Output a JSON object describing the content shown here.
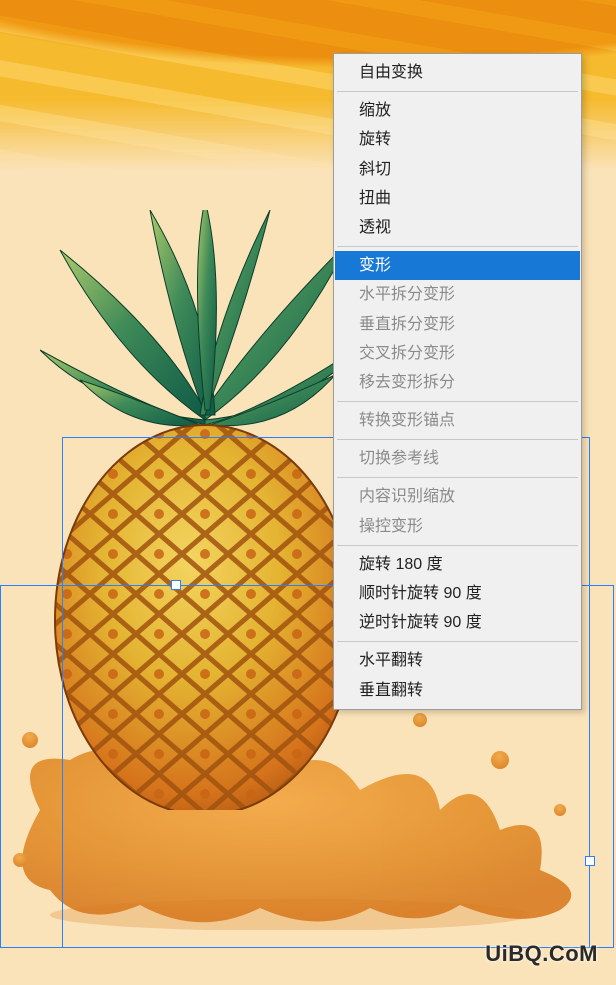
{
  "menu": {
    "groups": [
      [
        {
          "label": "自由变换",
          "enabled": true,
          "highlight": false,
          "name": "menu-free-transform"
        }
      ],
      [
        {
          "label": "缩放",
          "enabled": true,
          "highlight": false,
          "name": "menu-scale"
        },
        {
          "label": "旋转",
          "enabled": true,
          "highlight": false,
          "name": "menu-rotate"
        },
        {
          "label": "斜切",
          "enabled": true,
          "highlight": false,
          "name": "menu-skew"
        },
        {
          "label": "扭曲",
          "enabled": true,
          "highlight": false,
          "name": "menu-distort"
        },
        {
          "label": "透视",
          "enabled": true,
          "highlight": false,
          "name": "menu-perspective"
        }
      ],
      [
        {
          "label": "变形",
          "enabled": true,
          "highlight": true,
          "name": "menu-warp"
        },
        {
          "label": "水平拆分变形",
          "enabled": false,
          "highlight": false,
          "name": "menu-split-warp-h"
        },
        {
          "label": "垂直拆分变形",
          "enabled": false,
          "highlight": false,
          "name": "menu-split-warp-v"
        },
        {
          "label": "交叉拆分变形",
          "enabled": false,
          "highlight": false,
          "name": "menu-split-warp-cross"
        },
        {
          "label": "移去变形拆分",
          "enabled": false,
          "highlight": false,
          "name": "menu-remove-warp-split"
        }
      ],
      [
        {
          "label": "转换变形锚点",
          "enabled": false,
          "highlight": false,
          "name": "menu-convert-warp-anchor"
        }
      ],
      [
        {
          "label": "切换参考线",
          "enabled": false,
          "highlight": false,
          "name": "menu-toggle-guides"
        }
      ],
      [
        {
          "label": "内容识别缩放",
          "enabled": false,
          "highlight": false,
          "name": "menu-content-aware-scale"
        },
        {
          "label": "操控变形",
          "enabled": false,
          "highlight": false,
          "name": "menu-puppet-warp"
        }
      ],
      [
        {
          "label": "旋转 180 度",
          "enabled": true,
          "highlight": false,
          "name": "menu-rotate-180"
        },
        {
          "label": "顺时针旋转 90 度",
          "enabled": true,
          "highlight": false,
          "name": "menu-rotate-90-cw"
        },
        {
          "label": "逆时针旋转 90 度",
          "enabled": true,
          "highlight": false,
          "name": "menu-rotate-90-ccw"
        }
      ],
      [
        {
          "label": "水平翻转",
          "enabled": true,
          "highlight": false,
          "name": "menu-flip-h"
        },
        {
          "label": "垂直翻转",
          "enabled": true,
          "highlight": false,
          "name": "menu-flip-v"
        }
      ]
    ]
  },
  "colors": {
    "menu_highlight": "#1878d6",
    "selection_border": "#2680ff",
    "background": "#fbe3b9",
    "brushstroke": "#f5b827"
  },
  "watermark": {
    "text": "UiBQ.CoM"
  },
  "artwork": {
    "subject": "pineapple",
    "leaves_color_dark": "#0f5a46",
    "leaves_color_light": "#6aaf53",
    "body_color_top": "#e4c53a",
    "body_color_bottom": "#d5721b",
    "splash_color": "#e28a22"
  }
}
